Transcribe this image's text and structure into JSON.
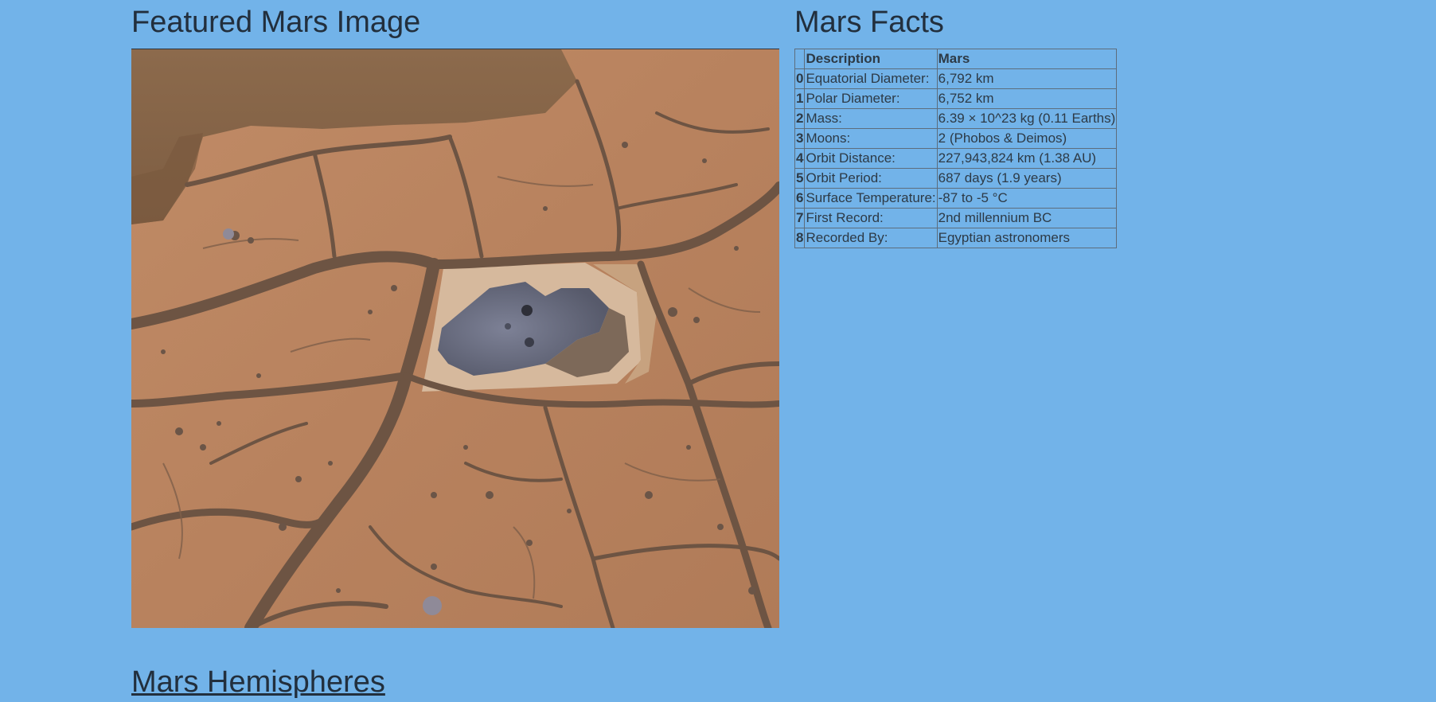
{
  "featured": {
    "title": "Featured Mars Image"
  },
  "facts": {
    "title": "Mars Facts",
    "columns": [
      "",
      "Description",
      "Mars"
    ],
    "rows": [
      {
        "index": "0",
        "description": "Equatorial Diameter:",
        "value": "6,792 km"
      },
      {
        "index": "1",
        "description": "Polar Diameter:",
        "value": "6,752 km"
      },
      {
        "index": "2",
        "description": "Mass:",
        "value": "6.39 × 10^23 kg (0.11 Earths)"
      },
      {
        "index": "3",
        "description": "Moons:",
        "value": "2 (Phobos & Deimos)"
      },
      {
        "index": "4",
        "description": "Orbit Distance:",
        "value": "227,943,824 km (1.38 AU)"
      },
      {
        "index": "5",
        "description": "Orbit Period:",
        "value": "687 days (1.9 years)"
      },
      {
        "index": "6",
        "description": "Surface Temperature:",
        "value": "-87 to -5 °C"
      },
      {
        "index": "7",
        "description": "First Record:",
        "value": "2nd millennium BC"
      },
      {
        "index": "8",
        "description": "Recorded By:",
        "value": "Egyptian astronomers"
      }
    ]
  },
  "hemispheres": {
    "title": "Mars Hemispheres"
  },
  "colors": {
    "page_background": "#72b3e9",
    "heading_text": "#222f3d",
    "mars_soil": "#b98561",
    "mars_sand": "#8a6748",
    "mars_crack": "#6e5443",
    "rock_gray": "#6a6f83"
  }
}
